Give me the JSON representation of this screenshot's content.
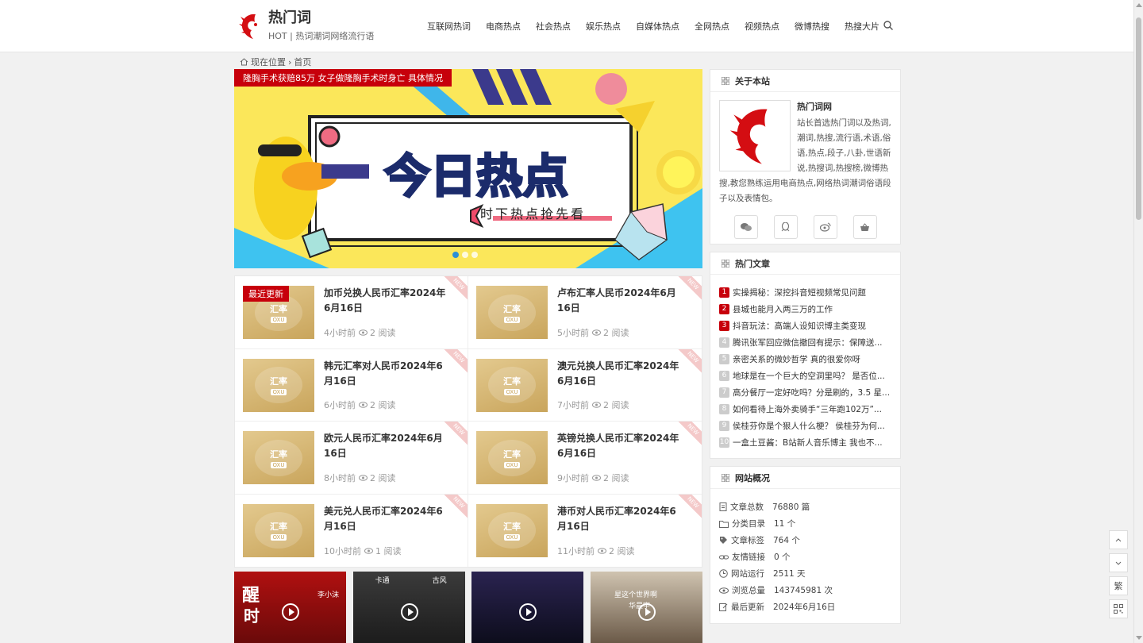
{
  "header": {
    "logo_title": "热门词",
    "logo_subtitle": "HOT | 热词潮词网络流行语",
    "nav": [
      "互联网热词",
      "电商热点",
      "社会热点",
      "娱乐热点",
      "自媒体热点",
      "全网热点",
      "视频热点",
      "微博热搜",
      "热搜大片"
    ]
  },
  "breadcrumb": {
    "location": "现在位置",
    "sep": "›",
    "home": "首页"
  },
  "banner": {
    "caption": "隆胸手术获赔85万 女子做隆胸手术时身亡 具体情况",
    "headline": "今日热点",
    "tagline": "时下热点抢先看"
  },
  "articles": {
    "latest_tag": "最近更新",
    "new_label": "NEW",
    "thumb_big": "汇率",
    "thumb_small": "OXU",
    "items": [
      {
        "title": "加币兑换人民币汇率2024年6月16日",
        "time": "4小时前",
        "views": "2 阅读"
      },
      {
        "title": "卢布汇率人民币2024年6月16日",
        "time": "5小时前",
        "views": "2 阅读"
      },
      {
        "title": "韩元汇率对人民币2024年6月16日",
        "time": "6小时前",
        "views": "2 阅读"
      },
      {
        "title": "澳元兑换人民币汇率2024年6月16日",
        "time": "7小时前",
        "views": "2 阅读"
      },
      {
        "title": "欧元人民币汇率2024年6月16日",
        "time": "8小时前",
        "views": "2 阅读"
      },
      {
        "title": "英镑兑换人民币汇率2024年6月16日",
        "time": "9小时前",
        "views": "2 阅读"
      },
      {
        "title": "美元兑人民币汇率2024年6月16日",
        "time": "10小时前",
        "views": "1 阅读"
      },
      {
        "title": "港币对人民币汇率2024年6月16日",
        "time": "11小时前",
        "views": "2 阅读"
      }
    ]
  },
  "videos": {
    "v1_big": "醒",
    "v1_big2": "时",
    "v1_name": "李小沫",
    "v2_left": "卡通",
    "v2_right": "古风",
    "v4_line1": "星这个世界啊",
    "v4_line2": "华晨宇"
  },
  "about": {
    "heading": "关于本站",
    "name": "热门词网",
    "text": "站长首选热门词以及热词,潮词,热搜,流行语,术语,俗语,热点,段子,八卦,世语新说,热搜词,热搜榜,微博热搜,教您熟练运用电商热点,网络热词潮词俗语段子以及表情包。"
  },
  "hot": {
    "heading": "热门文章",
    "items": [
      "实操揭秘：深挖抖音短视频常见问题",
      "县城也能月入两三万的工作",
      "抖音玩法：高端人设知识博主类变现",
      "腾讯张军回应微信撤回有提示：保障送...",
      "亲密关系的微妙哲学 真的很爱你呀",
      "地球是在一个巨大的空洞里吗？ 是否位...",
      "高分餐厅一定好吃吗？分是刷的，3.5 星...",
      "如何看待上海外卖骑手“三年跑102万”...",
      "侯桂芬你是个狠人什么梗？ 侯桂芬为何...",
      "一盒土豆酱：B站新人音乐博主 我也不..."
    ]
  },
  "stats": {
    "heading": "网站概况",
    "items": [
      {
        "label": "文章总数",
        "value": "76880 篇"
      },
      {
        "label": "分类目录",
        "value": "11 个"
      },
      {
        "label": "文章标签",
        "value": "764 个"
      },
      {
        "label": "友情链接",
        "value": "0 个"
      },
      {
        "label": "网站运行",
        "value": "2511 天"
      },
      {
        "label": "浏览总量",
        "value": "143745981 次"
      },
      {
        "label": "最后更新",
        "value": "2024年6月16日"
      }
    ]
  },
  "float_tools": {
    "trad": "繁"
  },
  "colors": {
    "accent": "#c7000b",
    "dot_active": "#2b8fd6",
    "thumb_gold": "#c9a55c"
  }
}
